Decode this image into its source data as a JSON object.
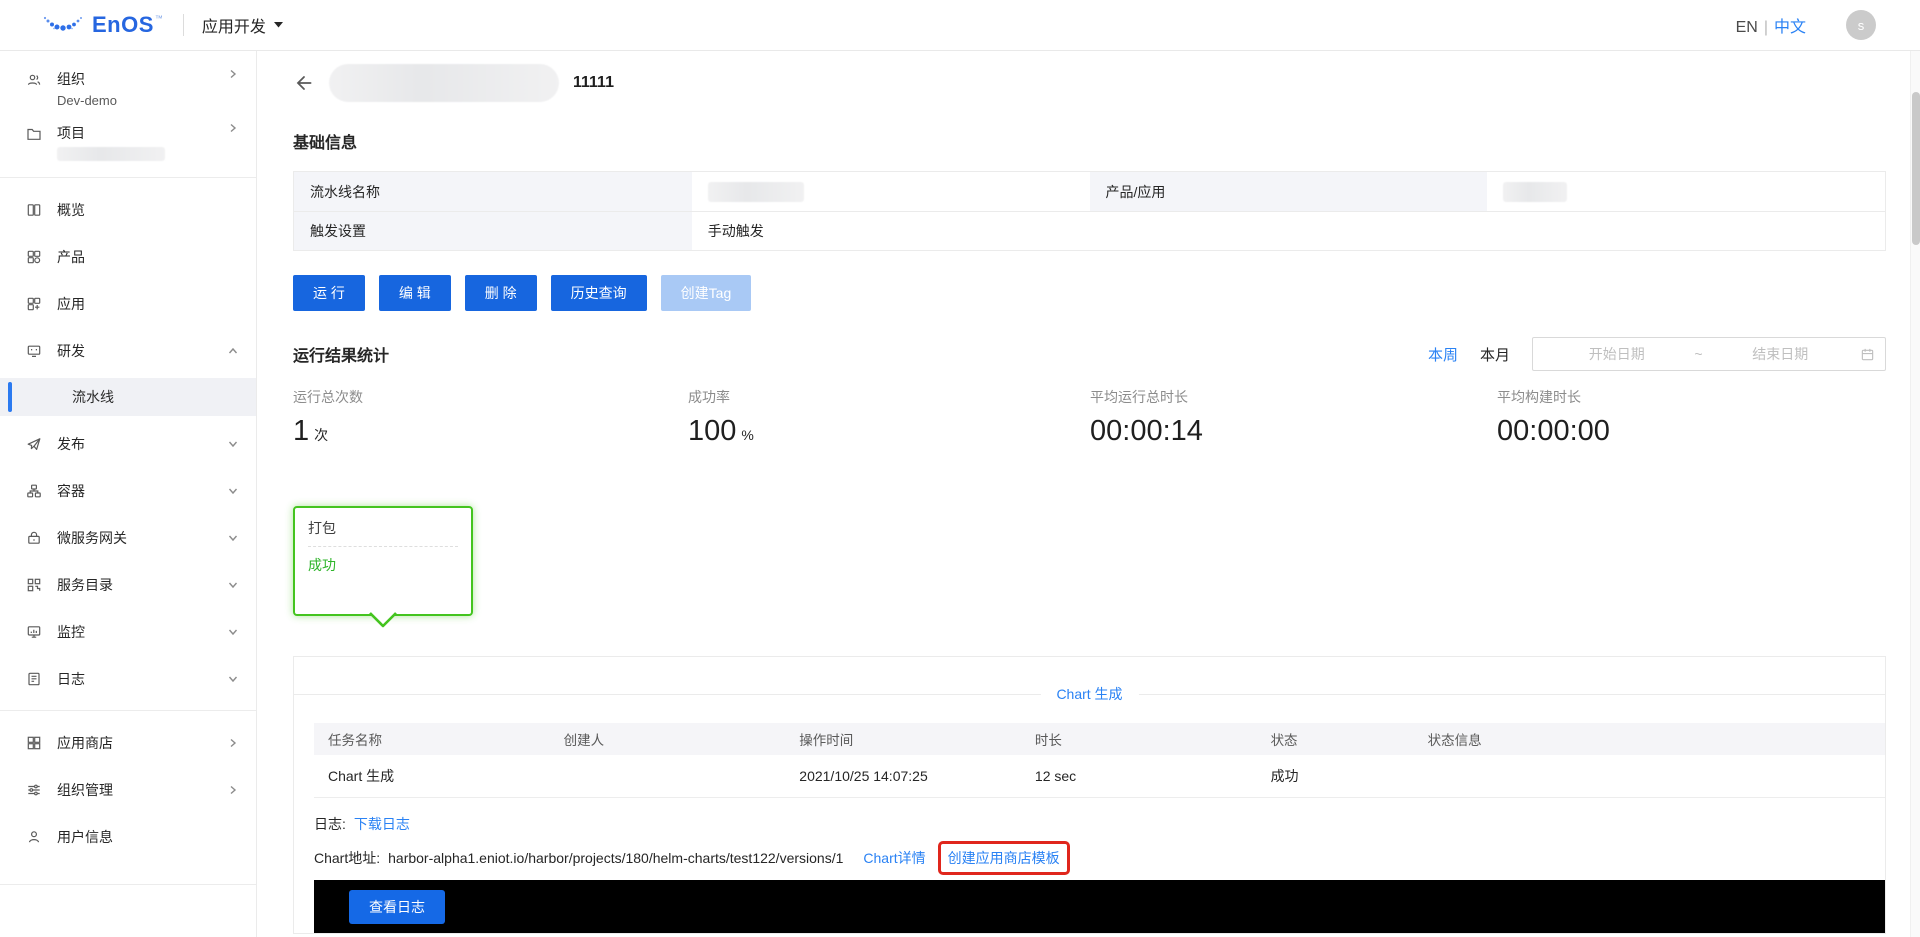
{
  "topbar": {
    "brand": "EnOS",
    "tm": "™",
    "app_switcher": "应用开发",
    "lang_en": "EN",
    "lang_sep": "|",
    "lang_zh": "中文",
    "avatar_initial": "s"
  },
  "sidebar": {
    "org_label": "组织",
    "org_value": "Dev-demo",
    "project_label": "项目",
    "overview": "概览",
    "product": "产品",
    "app": "应用",
    "dev": "研发",
    "pipeline": "流水线",
    "release": "发布",
    "container": "容器",
    "gateway": "微服务网关",
    "catalog": "服务目录",
    "monitor": "监控",
    "log": "日志",
    "appstore": "应用商店",
    "org_mgmt": "组织管理",
    "user_info": "用户信息"
  },
  "page": {
    "title": "11111"
  },
  "basic_info": {
    "title": "基础信息",
    "pipeline_name_label": "流水线名称",
    "product_app_label": "产品/应用",
    "trigger_label": "触发设置",
    "trigger_value": "手动触发"
  },
  "actions": {
    "run": "运 行",
    "edit": "编 辑",
    "delete": "删 除",
    "history": "历史查询",
    "create_tag": "创建Tag"
  },
  "stats": {
    "title": "运行结果统计",
    "week": "本周",
    "month": "本月",
    "date_start_placeholder": "开始日期",
    "date_separator": "~",
    "date_end_placeholder": "结束日期",
    "items": [
      {
        "label": "运行总次数",
        "value": "1",
        "unit": "次"
      },
      {
        "label": "成功率",
        "value": "100",
        "unit": "%"
      },
      {
        "label": "平均运行总时长",
        "value": "00:00:14",
        "unit": ""
      },
      {
        "label": "平均构建时长",
        "value": "00:00:00",
        "unit": ""
      }
    ]
  },
  "stage": {
    "name": "打包",
    "status": "成功"
  },
  "panel": {
    "tab": "Chart 生成",
    "table": {
      "headers": [
        "任务名称",
        "创建人",
        "操作时间",
        "时长",
        "状态",
        "状态信息"
      ],
      "row": {
        "task": "Chart 生成",
        "time": "2021/10/25 14:07:25",
        "duration": "12 sec",
        "status": "成功",
        "status_info": ""
      }
    },
    "log_label": "日志:",
    "log_link": "下载日志",
    "addr_label": "Chart地址:",
    "addr_value": "harbor-alpha1.eniot.io/harbor/projects/180/helm-charts/test122/versions/1",
    "detail_link": "Chart详情",
    "create_store_template_link": "创建应用商店模板",
    "view_log_button": "查看日志"
  },
  "colors": {
    "primary_blue": "#1766df",
    "link_blue": "#2a82f4",
    "success_green": "#44c41f",
    "annotation_red": "#e0261c"
  }
}
